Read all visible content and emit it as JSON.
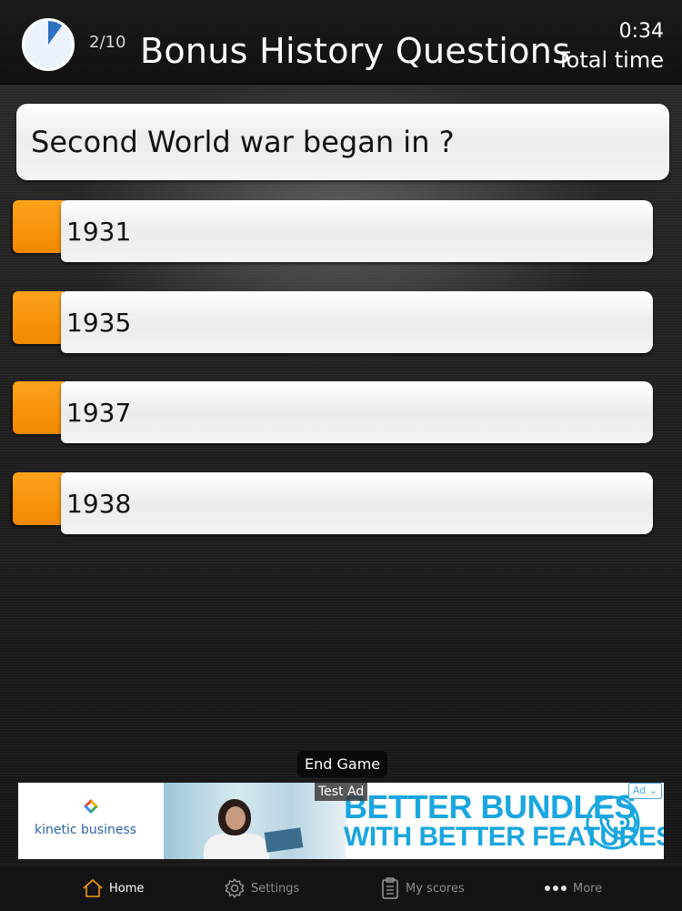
{
  "header": {
    "progress": "2/10",
    "title": "Bonus History Questions",
    "time_value": "0:34",
    "time_label": "Total time",
    "timer_fraction_elapsed": 0.1
  },
  "question": {
    "text": "Second World war began in ?"
  },
  "answers": [
    {
      "label": "1931"
    },
    {
      "label": "1935"
    },
    {
      "label": "1937"
    },
    {
      "label": "1938"
    }
  ],
  "end_game_label": "End Game",
  "ad": {
    "test_label": "Test Ad",
    "badge": "Ad",
    "brand_word1": "kinetic",
    "brand_word2": "business",
    "headline_line1": "BETTER BUNDLES",
    "headline_line2": "WITH BETTER FEATURES"
  },
  "tabbar": {
    "items": [
      {
        "label": "Home",
        "icon": "home-icon"
      },
      {
        "label": "Settings",
        "icon": "gear-icon"
      },
      {
        "label": "My scores",
        "icon": "clipboard-icon"
      },
      {
        "label": "More",
        "icon": "more-dots-icon"
      }
    ]
  },
  "colors": {
    "accent_orange": "#f08900",
    "timer_blue": "#2f6fc4",
    "ad_blue": "#1aa6df"
  }
}
